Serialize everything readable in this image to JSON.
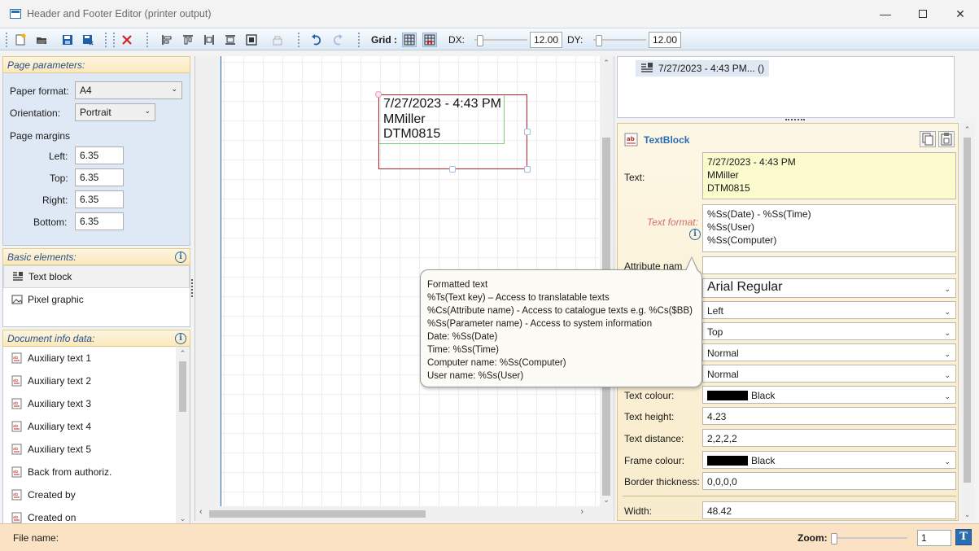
{
  "window": {
    "title": "Header and Footer Editor (printer output)",
    "minimize_glyph": "—",
    "close_glyph": "✕"
  },
  "toolbar": {
    "grid_label": "Grid :",
    "dx_label": "DX:",
    "dx_value": "12.00",
    "dy_label": "DY:",
    "dy_value": "12.00",
    "icons": [
      "new-icon",
      "open-icon",
      "save-icon",
      "save-as-icon",
      "delete-icon",
      "align-left-icon",
      "align-top-icon",
      "align-right-icon",
      "align-center-icon",
      "center-icon",
      "lock-icon",
      "undo-icon",
      "redo-icon",
      "grid-icon",
      "snap-grid-icon"
    ]
  },
  "page_parameters": {
    "heading": "Page parameters:",
    "paper_format_label": "Paper format:",
    "paper_format_value": "A4",
    "orientation_label": "Orientation:",
    "orientation_value": "Portrait",
    "page_margins_label": "Page margins",
    "left_label": "Left:",
    "left_value": "6.35",
    "top_label": "Top:",
    "top_value": "6.35",
    "right_label": "Right:",
    "right_value": "6.35",
    "bottom_label": "Bottom:",
    "bottom_value": "6.35"
  },
  "basic_elements": {
    "heading": "Basic elements:",
    "items": [
      {
        "label": "Text block",
        "icon": "text-block-icon"
      },
      {
        "label": "Pixel graphic",
        "icon": "image-icon"
      }
    ]
  },
  "document_info": {
    "heading": "Document info data:",
    "items": [
      {
        "label": "Auxiliary text 1"
      },
      {
        "label": "Auxiliary text 2"
      },
      {
        "label": "Auxiliary text 3"
      },
      {
        "label": "Auxiliary text 4"
      },
      {
        "label": "Auxiliary text 5"
      },
      {
        "label": "Back from authoriz."
      },
      {
        "label": "Created by"
      },
      {
        "label": "Created on"
      }
    ]
  },
  "canvas": {
    "text_lines": [
      "7/27/2023 - 4:43 PM",
      "MMiller",
      "DTM0815"
    ]
  },
  "tree": {
    "item_label": "7/27/2023 - 4:43 PM... ()"
  },
  "properties": {
    "heading": "TextBlock",
    "text_label": "Text:",
    "text_lines": [
      "7/27/2023 - 4:43 PM",
      "MMiller",
      "DTM0815"
    ],
    "text_format_label": "Text format:",
    "text_format_lines": [
      "%Ss(Date) - %Ss(Time)",
      "%Ss(User)",
      "%Ss(Computer)"
    ],
    "attribute_name_label": "Attribute nam",
    "font_value": "Arial Regular",
    "halign_value": "Left",
    "valign_value": "Top",
    "style1_value": "Normal",
    "style2_value": "Normal",
    "text_colour_label": "Text colour:",
    "text_colour_value": "Black",
    "text_height_label": "Text height:",
    "text_height_value": "4.23",
    "text_distance_label": "Text distance:",
    "text_distance_value": "2,2,2,2",
    "frame_colour_label": "Frame colour:",
    "frame_colour_value": "Black",
    "border_thickness_label": "Border thickness:",
    "border_thickness_value": "0,0,0,0",
    "width_label": "Width:",
    "width_value": "48.42"
  },
  "tooltip": {
    "lines": [
      "Formatted text",
      "%Ts(Text key) – Access to translatable texts",
      "%Cs(Attribute name) - Access to catalogue texts e.g. %Cs($BB)",
      "%Ss(Parameter name) - Access to system information",
      "Date:   %Ss(Date)",
      "Time:  %Ss(Time)",
      "Computer name: %Ss(Computer)",
      "User name: %Ss(User)"
    ]
  },
  "statusbar": {
    "file_name_label": "File name:",
    "zoom_label": "Zoom:",
    "zoom_value": "1",
    "zoom_button": "T"
  },
  "colors": {
    "accent": "#2a6db0",
    "selection_frame": "#c0202c",
    "statusbar_bg": "#fbe2c4"
  }
}
